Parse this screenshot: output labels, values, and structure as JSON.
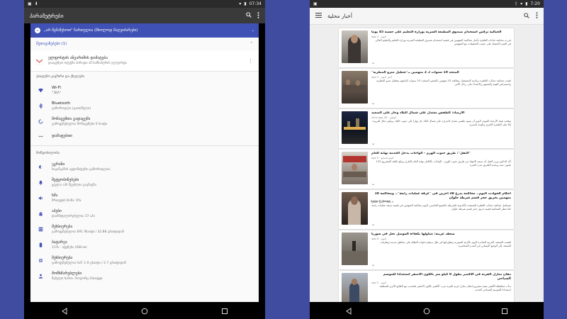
{
  "left": {
    "status": {
      "time": "07:34"
    },
    "appbar": {
      "title": "პარამეტრები"
    },
    "banner": {
      "text": "„არ შემაწუხოთ\" ჩართულია (მხოლოდ მაღვიძარები)"
    },
    "suggestions": {
      "header": "შეთავაზებები (1)",
      "card": {
        "title": "ელფოსტის ანგარიშის დამატება",
        "subtitle": "დააყენეთ თქვენი პირადი ან სამსახურის ელფოსტა"
      }
    },
    "section_wireless": "უსადენო კავშირი და ქსელები",
    "wireless_items": [
      {
        "title": "Wi-Fi",
        "subtitle": "\"3BA\"",
        "icon": "wifi-icon"
      },
      {
        "title": "Bluetooth",
        "subtitle": "გამორთული (გათიშული)",
        "icon": "bluetooth-icon"
      },
      {
        "title": "მონაცემთა გადაცემა",
        "subtitle": "გამოყენებულია მონაცემები 0 ბაიტი",
        "icon": "data-usage-icon"
      },
      {
        "title": "დამატებით",
        "subtitle": "",
        "icon": "more-icon"
      }
    ],
    "section_device": "მოწყობილობა",
    "device_items": [
      {
        "title": "ეკრანი",
        "subtitle": "სიკაშკაშის ავტომატური გამორთულია",
        "icon": "brightness-icon"
      },
      {
        "title": "შეტყობინებები",
        "subtitle": "ყველა აპს შეუძლია გაგზავნა",
        "icon": "bell-icon"
      },
      {
        "title": "ხმა",
        "subtitle": "შრიფტის ზომა: 0%",
        "icon": "volume-icon"
      },
      {
        "title": "აპები",
        "subtitle": "დაინსტალირებულია 37 აპი",
        "icon": "android-icon"
      },
      {
        "title": "მეხსიერება",
        "subtitle": "გამოყენებულია 691 მბაიტი / 32.88 გბაიტიდან",
        "icon": "storage-icon"
      },
      {
        "title": "ბატარეა",
        "subtitle": "11% - იტენება USB-ით",
        "icon": "battery-icon"
      },
      {
        "title": "მეხსიერება",
        "subtitle": "გამოყენებულია საშ. 1.9 გბაიტი / 2.7 გბაიტიდან",
        "icon": "memory-icon"
      },
      {
        "title": "მომხმარებლები",
        "subtitle": "შესული ხართ, როგორც Xiangge",
        "icon": "user-icon"
      }
    ]
  },
  "right": {
    "status": {
      "time": "7:20"
    },
    "appbar": {
      "title": "أخبار محلية"
    },
    "cards": [
      {
        "title": "الجبالية ترفض استخدام صندوق المطبعة السرية بوزارة التعليم على حسبه 45 يوما",
        "meta": "اليوم · ago 3",
        "excerpt": "قررت محكمة جنايات القاهرة تأجيل محاكمة المتهمين في قضية استخدام صندوق المطبعة السرية بوزارة التعليم والتعليم العالي في الفترة المقبلة على حسب التحقيقات مع المتهمين",
        "thumb": "man-portrait-thumb"
      },
      {
        "title": "المتحد 10 سنوات لـ 2 متهمين بـ\"تعطيل مترو المطرية\"",
        "meta": "أخبار اليوم · ago 4",
        "excerpt": "قضت محكمة جنايات القاهرة برئاسة المستشار بمعاقبة 10 متهمين بالسجن المشدد 10 سنوات لإدانتهم بتعطيل مترو المطرية واستعراض القوة والتجمهر والاعتداء على رجال الأمن",
        "thumb": "courtroom-thumb"
      },
      {
        "title": "الأرصاد: الطقس معتدل على شمال البلاد وحار على الصعيد",
        "meta": "الوطن · mins ago 49",
        "excerpt": "توقعت هيئة الأرصاد الجوية، اليوم أن يسود طقس معتدل الحرارة على شمال البلاد حار نهارا على جنوب البلاد، ويكون مائل للبرودة ليلا على القاهرة الكبرى والوجه البحري",
        "thumb": "city-night-thumb"
      },
      {
        "title": "\"النقل\": طريق جنوب الهرم - الواحات يدخل الخدمة نهاية العام",
        "meta": "اليوم السابع · ago 5",
        "excerpt": "أكد الدكتور وزير النقل أنه سيتم الانتهاء من طريق جنوب الهرم - الواحات بالكامل نهاية العام الجاري وتبلغ تكلفة المشروع 125 مليون جنيه ويخدم الطريق مدن الجيزة",
        "thumb": "meeting-thumb"
      },
      {
        "title": "أحكام الحوادث اليوم.. محاكمة بدرع 38 آخرين في \"غرفة عمليات رابعة\".. ومحاكمة 10 متهمين بحريق حجز قسم شرطة حلوان",
        "meta": "ago 6 · اليوم السابع",
        "excerpt": "تستكمل محكمة جنايات القاهرة المنعقدة بأكاديمية الشرطة بالتجمع الخامس، اليوم محاكمة المتهمين في قضية غرفة عمليات رابعة كما تنظر المحكمة قضية حريق حجز قسم شرطة حلوان",
        "thumb": "defendant-thumb",
        "badge": "Sada El Balad"
      },
      {
        "title": "صحف عربية: تتناولها بكفاءة الموصل تحل في سوريا",
        "meta": "اليوم · ago 6",
        "excerpt": "اهتمت الصحف العربية الصادرة اليوم بالأزمة السورية وتطوراتها في ظل سيطرة قوات النظام على مناطق جديدة وتطرقت الصحف إلى الوضع الإنساني في المدن المحاصرة",
        "thumb": "ruins-thumb"
      },
      {
        "title": "دهان منازل القرنة في الأقصر بطول 8 كيلو متر بالكون الأصفر استعدادا للموسم السياحي",
        "meta": "اليوم · ago 5",
        "excerpt": "بدأت محافظة الأقصر تنفيذ مشروع لدهان منازل قرية القرنة غرب الأقصر باللون الأصفر لتتناسب مع الطابع الأثري للمنطقة استعدادا للموسم السياحي الجديد",
        "thumb": "worker-thumb"
      }
    ]
  }
}
